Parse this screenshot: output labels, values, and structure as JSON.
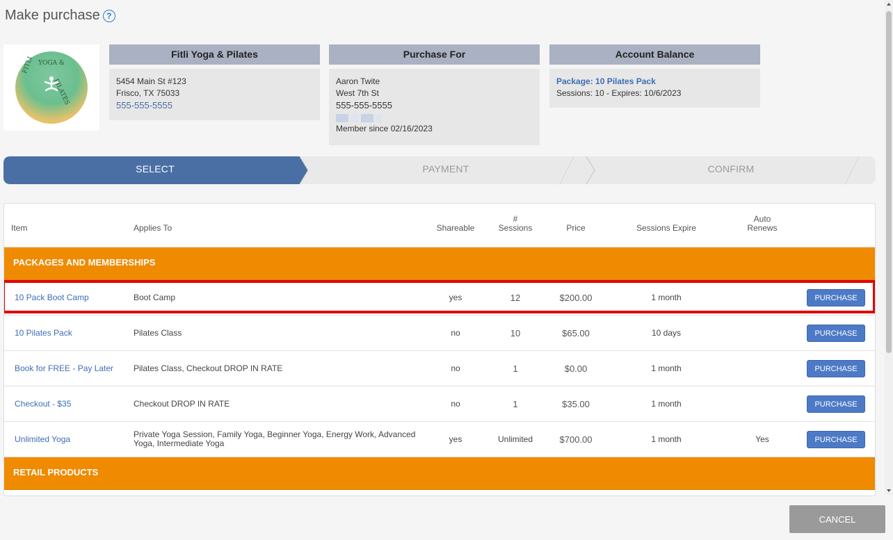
{
  "page": {
    "title": "Make purchase",
    "help_icon": "?"
  },
  "business": {
    "header": "Fitli Yoga & Pilates",
    "address1": "5454 Main St #123",
    "address2": "Frisco, TX 75033",
    "phone": "555-555-5555",
    "logo_text_top": "YOGA &",
    "logo_text_left": "FITLI",
    "logo_text_right": "PILATES"
  },
  "purchase_for": {
    "header": "Purchase For",
    "name": "Aaron Twite",
    "street": "West 7th St",
    "phone": "555-555-5555",
    "member_since": "Member since 02/16/2023"
  },
  "account_balance": {
    "header": "Account Balance",
    "package": "Package: 10 Pilates Pack",
    "sessions": "Sessions: 10 - Expires: 10/6/2023"
  },
  "steps": {
    "select": "SELECT",
    "payment": "PAYMENT",
    "confirm": "CONFIRM",
    "active_color": "#4a6fa5"
  },
  "table": {
    "headers": {
      "item": "Item",
      "applies_to": "Applies To",
      "shareable": "Shareable",
      "sessions_hash": "#",
      "sessions": "Sessions",
      "price": "Price",
      "expire": "Sessions Expire",
      "auto": "Auto",
      "renews": "Renews"
    },
    "section_packages": "PACKAGES AND MEMBERSHIPS",
    "section_retail": "RETAIL PRODUCTS",
    "purchase_label": "PURCHASE",
    "rows": [
      {
        "item": "10 Pack Boot Camp",
        "applies": "Boot Camp",
        "shareable": "yes",
        "sessions": "12",
        "price": "$200.00",
        "expire": "1 month",
        "renews": ""
      },
      {
        "item": "10 Pilates Pack",
        "applies": "Pilates Class",
        "shareable": "no",
        "sessions": "10",
        "price": "$65.00",
        "expire": "10 days",
        "renews": ""
      },
      {
        "item": "Book for FREE - Pay Later",
        "applies": "Pilates Class, Checkout DROP IN RATE",
        "shareable": "no",
        "sessions": "1",
        "price": "$0.00",
        "expire": "1 month",
        "renews": ""
      },
      {
        "item": "Checkout - $35",
        "applies": "Checkout DROP IN RATE",
        "shareable": "no",
        "sessions": "1",
        "price": "$35.00",
        "expire": "1 month",
        "renews": ""
      },
      {
        "item": "Unlimited Yoga",
        "applies": "Private Yoga Session, Family Yoga, Beginner Yoga, Energy Work, Advanced Yoga, Intermediate Yoga",
        "shareable": "yes",
        "sessions": "Unlimited",
        "price": "$700.00",
        "expire": "1 month",
        "renews": "Yes"
      }
    ]
  },
  "footer": {
    "cancel": "CANCEL"
  }
}
